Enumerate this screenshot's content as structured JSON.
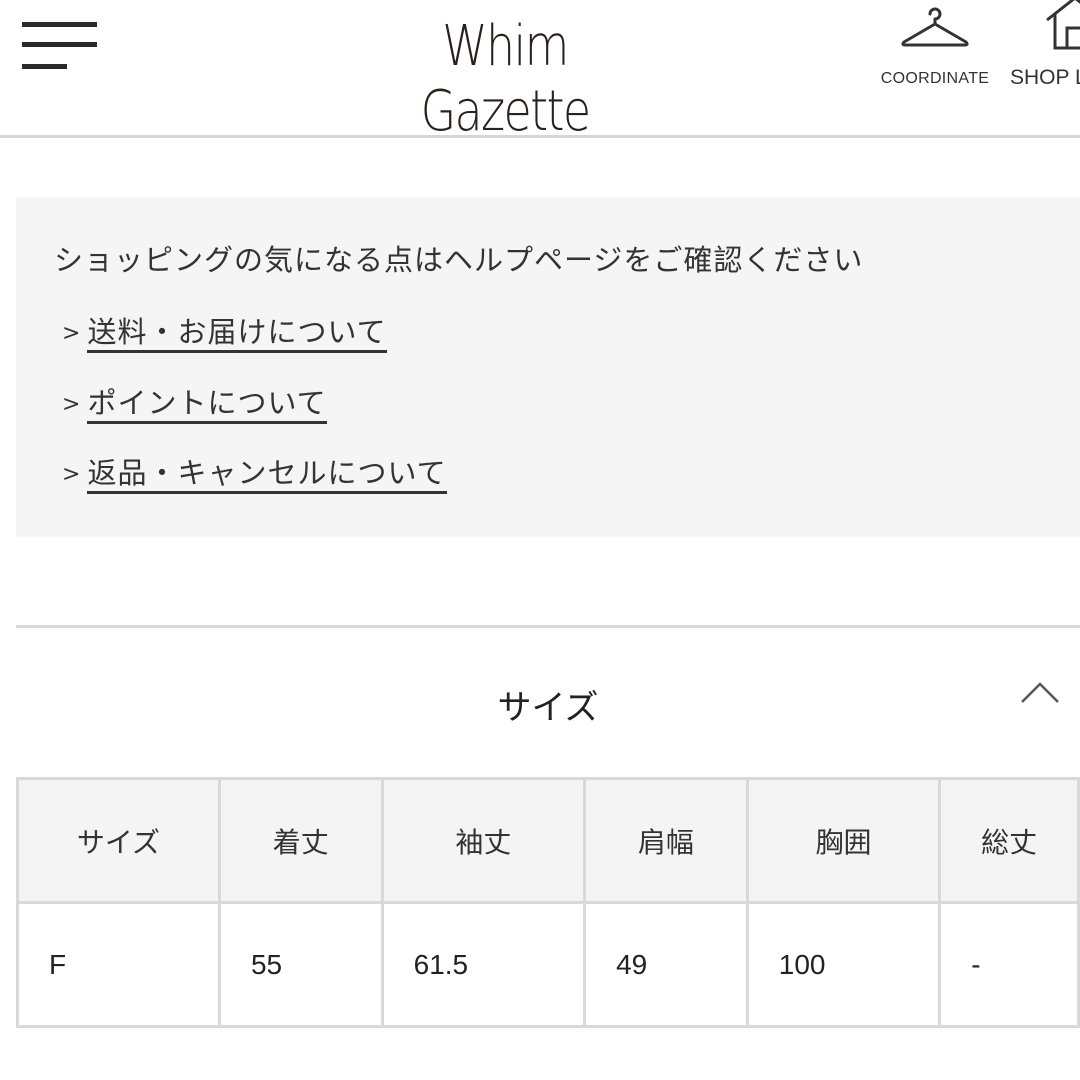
{
  "header": {
    "menu_icon": "hamburger-menu-icon",
    "logo_text": "Whim Gazette",
    "nav": [
      {
        "label": "COORDINATE",
        "icon": "hanger-icon"
      },
      {
        "label": "SHOP L",
        "icon": "house-icon"
      }
    ]
  },
  "help": {
    "title": "ショッピングの気になる点はヘルプページをご確認ください",
    "arrow": ">",
    "links": [
      {
        "label": "送料・お届けについて"
      },
      {
        "label": "ポイントについて"
      },
      {
        "label": "返品・キャンセルについて"
      }
    ]
  },
  "size_section": {
    "title": "サイズ",
    "toggle_icon": "chevron-up-icon",
    "expanded": true,
    "table": {
      "headers": [
        "サイズ",
        "着丈",
        "袖丈",
        "肩幅",
        "胸囲",
        "総丈"
      ],
      "rows": [
        [
          "F",
          "55",
          "61.5",
          "49",
          "100",
          "-"
        ]
      ]
    }
  }
}
